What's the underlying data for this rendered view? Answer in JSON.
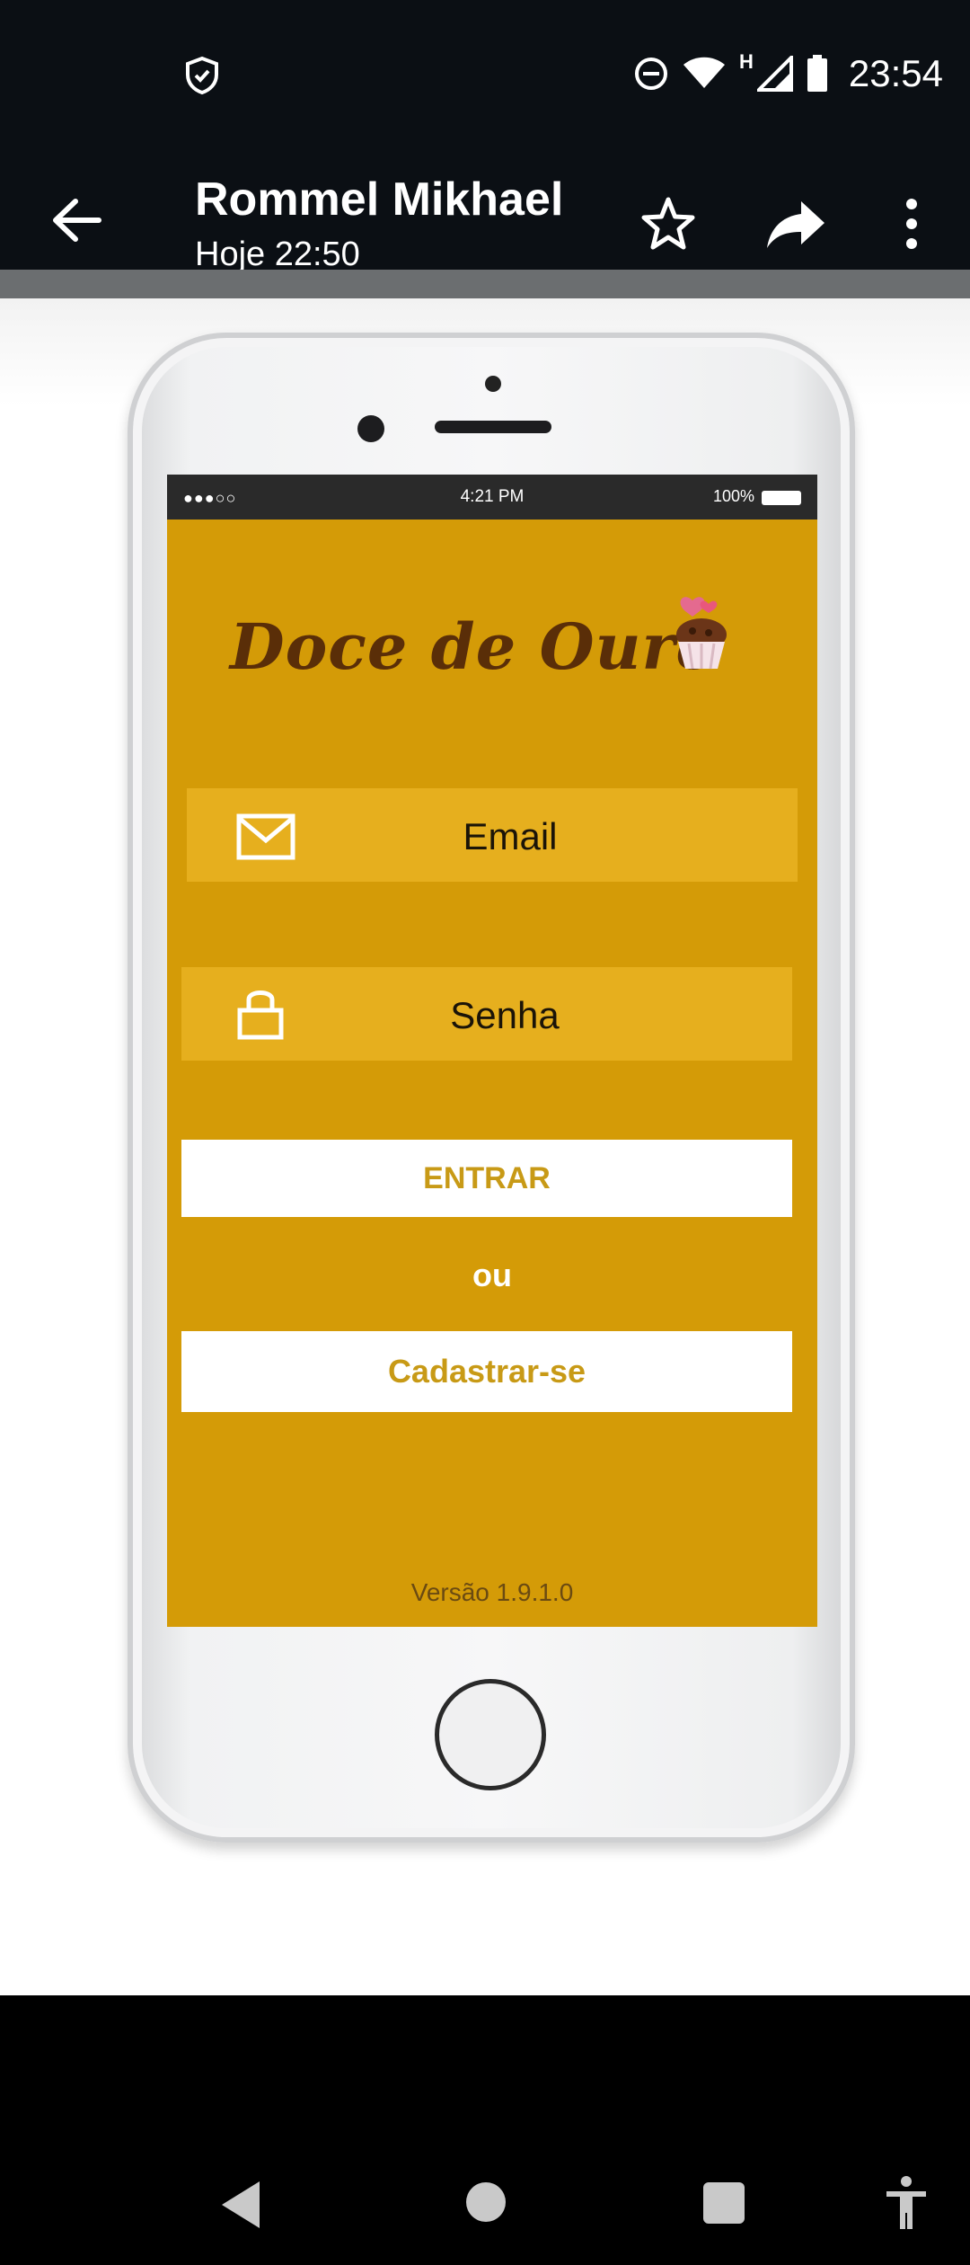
{
  "status_bar": {
    "time": "23:54",
    "network_label": "H",
    "icons": [
      "shield-icon",
      "do-not-disturb-icon",
      "wifi-icon",
      "signal-icon",
      "battery-icon"
    ]
  },
  "toolbar": {
    "title": "Rommel Mikhael",
    "subtitle": "Hoje 22:50",
    "icons": [
      "back-arrow-icon",
      "star-icon",
      "share-icon",
      "more-vert-icon"
    ]
  },
  "mockup": {
    "ios_status": {
      "signal": "●●●○○",
      "time": "4:21 PM",
      "battery": "100%"
    },
    "brand": "Doce de Ouro",
    "email_label": "Email",
    "senha_label": "Senha",
    "entrar_label": "ENTRAR",
    "ou_label": "ou",
    "cadastrar_label": "Cadastrar-se",
    "version": "Versão 1.9.1.0",
    "colors": {
      "background": "#d49b07",
      "field": "#e6af1e",
      "button_text": "#c89a16",
      "brand_text": "#5a2e08"
    }
  },
  "nav_bar": {
    "icons": [
      "nav-back-icon",
      "nav-home-icon",
      "nav-recents-icon",
      "accessibility-icon"
    ]
  }
}
